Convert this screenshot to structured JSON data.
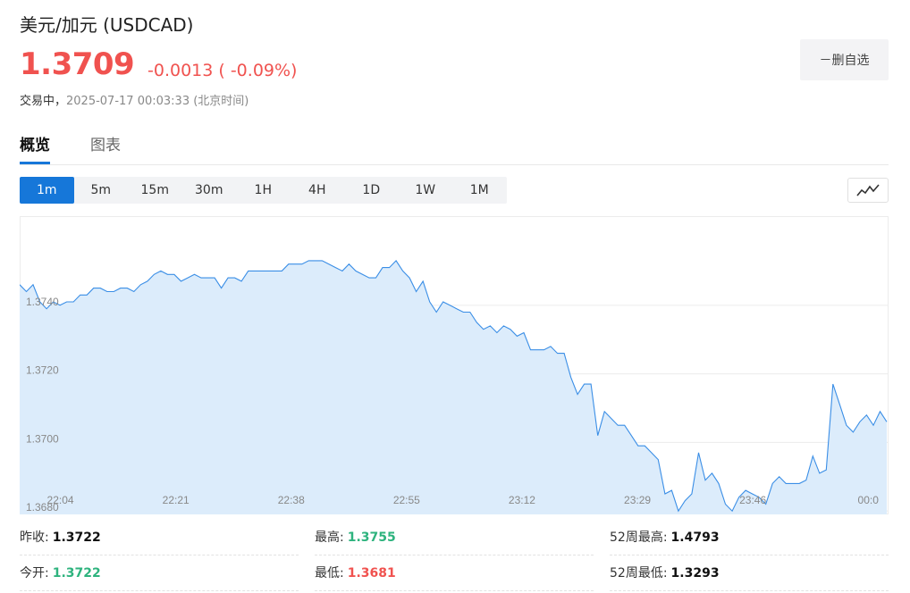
{
  "header": {
    "title": "美元/加元 (USDCAD)",
    "price": "1.3709",
    "change": "-0.0013 ( -0.09%)",
    "status_label": "交易中，",
    "timestamp": "2025-07-17 00:03:33 (北京时间)",
    "fav_button": "－删自选"
  },
  "tabs": [
    {
      "label": "概览",
      "active": true
    },
    {
      "label": "图表",
      "active": false
    }
  ],
  "periods": [
    {
      "label": "1m",
      "active": true
    },
    {
      "label": "5m"
    },
    {
      "label": "15m"
    },
    {
      "label": "30m"
    },
    {
      "label": "1H"
    },
    {
      "label": "4H"
    },
    {
      "label": "1D"
    },
    {
      "label": "1W"
    },
    {
      "label": "1M"
    }
  ],
  "chart_type_icon": "line-chart-icon",
  "colors": {
    "accent": "#1677d9",
    "down": "#f0524f",
    "up": "#2eb37e",
    "line": "#3a8ee6",
    "fill": "#dcecfb"
  },
  "chart_data": {
    "type": "area",
    "y_ticks": [
      "1.3740",
      "1.3720",
      "1.3700",
      "1.3680"
    ],
    "y_tick_values": [
      1.374,
      1.372,
      1.37,
      1.368
    ],
    "x_ticks": [
      "22:04",
      "22:21",
      "22:38",
      "22:55",
      "23:12",
      "23:29",
      "23:46",
      "00:0"
    ],
    "ylim": [
      1.3679,
      1.3766
    ],
    "x_range": [
      0,
      128
    ],
    "x_tick_positions": [
      6,
      23,
      40,
      57,
      74,
      91,
      108,
      125
    ],
    "grid": true,
    "series": [
      {
        "values": [
          1.3746,
          1.3744,
          1.3746,
          1.3741,
          1.3739,
          1.3741,
          1.374,
          1.3741,
          1.3741,
          1.3743,
          1.3743,
          1.3745,
          1.3745,
          1.3744,
          1.3744,
          1.3745,
          1.3745,
          1.3744,
          1.3746,
          1.3747,
          1.3749,
          1.375,
          1.3749,
          1.3749,
          1.3747,
          1.3748,
          1.3749,
          1.3748,
          1.3748,
          1.3748,
          1.3745,
          1.3748,
          1.3748,
          1.3747,
          1.375,
          1.375,
          1.375,
          1.375,
          1.375,
          1.375,
          1.3752,
          1.3752,
          1.3752,
          1.3753,
          1.3753,
          1.3753,
          1.3752,
          1.3751,
          1.375,
          1.3752,
          1.375,
          1.3749,
          1.3748,
          1.3748,
          1.3751,
          1.3751,
          1.3753,
          1.375,
          1.3748,
          1.3744,
          1.3747,
          1.3741,
          1.3738,
          1.3741,
          1.374,
          1.3739,
          1.3738,
          1.3738,
          1.3735,
          1.3733,
          1.3734,
          1.3732,
          1.3734,
          1.3733,
          1.3731,
          1.3732,
          1.3727,
          1.3727,
          1.3727,
          1.3728,
          1.3726,
          1.3726,
          1.3719,
          1.3714,
          1.3717,
          1.3717,
          1.3702,
          1.3709,
          1.3707,
          1.3705,
          1.3705,
          1.3702,
          1.3699,
          1.3699,
          1.3697,
          1.3695,
          1.3685,
          1.3686,
          1.368,
          1.3683,
          1.3685,
          1.3697,
          1.3689,
          1.3691,
          1.3688,
          1.3682,
          1.368,
          1.3684,
          1.3686,
          1.3685,
          1.3684,
          1.3682,
          1.3688,
          1.369,
          1.3688,
          1.3688,
          1.3688,
          1.3689,
          1.3696,
          1.3691,
          1.3692,
          1.3717,
          1.3711,
          1.3705,
          1.3703,
          1.3706,
          1.3708,
          1.3705,
          1.3709,
          1.3706
        ]
      }
    ]
  },
  "stats": [
    {
      "label": "昨收:",
      "value": "1.3722",
      "tone": "neutral"
    },
    {
      "label": "最高:",
      "value": "1.3755",
      "tone": "up"
    },
    {
      "label": "52周最高:",
      "value": "1.4793",
      "tone": "neutral"
    },
    {
      "label": "今开:",
      "value": "1.3722",
      "tone": "up"
    },
    {
      "label": "最低:",
      "value": "1.3681",
      "tone": "down"
    },
    {
      "label": "52周最低:",
      "value": "1.3293",
      "tone": "neutral"
    }
  ]
}
